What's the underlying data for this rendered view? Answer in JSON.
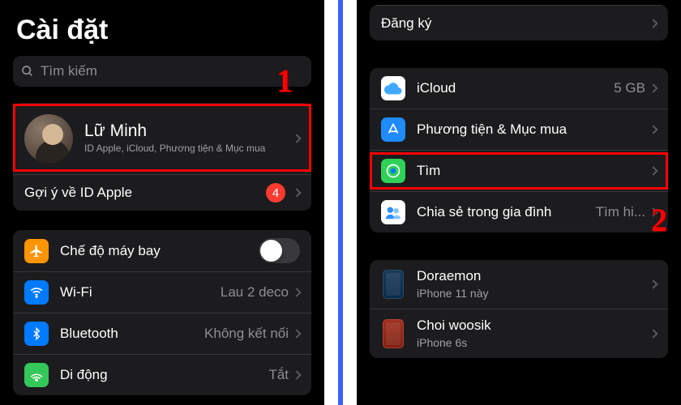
{
  "left": {
    "title": "Cài đặt",
    "search_placeholder": "Tìm kiếm",
    "profile": {
      "name": "Lữ Minh",
      "sub": "ID Apple, iCloud, Phương tiện & Mục mua"
    },
    "suggestion": {
      "label": "Gợi ý về ID Apple",
      "badge": "4"
    },
    "items": [
      {
        "label": "Chế độ máy bay"
      },
      {
        "label": "Wi-Fi",
        "detail": "Lau 2 deco"
      },
      {
        "label": "Bluetooth",
        "detail": "Không kết nối"
      },
      {
        "label": "Di động",
        "detail": "Tắt"
      }
    ]
  },
  "right": {
    "signup": "Đăng ký",
    "items": [
      {
        "label": "iCloud",
        "detail": "5 GB"
      },
      {
        "label": "Phương tiện & Mục mua"
      },
      {
        "label": "Tìm"
      },
      {
        "label": "Chia sẻ trong gia đình",
        "detail": "Tìm hi..."
      }
    ],
    "devices": [
      {
        "name": "Doraemon",
        "sub": "iPhone 11 này"
      },
      {
        "name": "Choi woosik",
        "sub": "iPhone 6s"
      }
    ]
  },
  "annot": {
    "one": "1",
    "two": "2"
  },
  "colors": {
    "airplane": "#ff9500",
    "wifi": "#007aff",
    "bluetooth": "#007aff",
    "cellular": "#34c759",
    "icloud_top": "#e8f4ff",
    "appstore": "#1f8bff",
    "find": "#30d158",
    "family": "#1f8bff"
  }
}
